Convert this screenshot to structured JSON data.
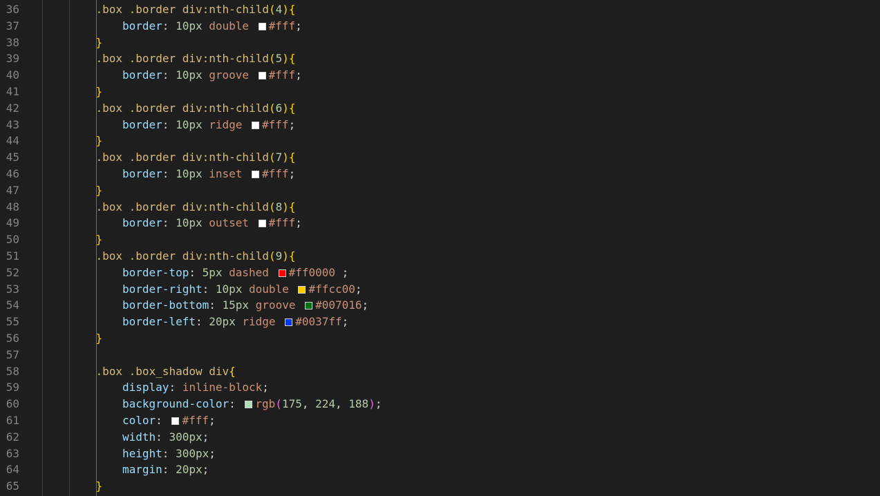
{
  "editor": {
    "language": "css",
    "line_count": 30,
    "lines": [
      {
        "num": "36",
        "indent": 1,
        "tokens": [
          {
            "t": ".box .border div:nth-child",
            "c": "sel"
          },
          {
            "t": "(",
            "c": "br"
          },
          {
            "t": "4",
            "c": "num"
          },
          {
            "t": ")",
            "c": "br"
          },
          {
            "t": "{",
            "c": "br"
          }
        ]
      },
      {
        "num": "37",
        "indent": 2,
        "tokens": [
          {
            "t": "border",
            "c": "prop"
          },
          {
            "t": ": ",
            "c": "punc"
          },
          {
            "t": "10px",
            "c": "num"
          },
          {
            "t": " double ",
            "c": "val"
          },
          {
            "swatch": "#ffffff",
            "name": "color-swatch"
          },
          {
            "t": "#fff",
            "c": "val"
          },
          {
            "t": ";",
            "c": "punc"
          }
        ]
      },
      {
        "num": "38",
        "indent": 1,
        "tokens": [
          {
            "t": "}",
            "c": "br"
          }
        ]
      },
      {
        "num": "39",
        "indent": 1,
        "tokens": [
          {
            "t": ".box .border div:nth-child",
            "c": "sel"
          },
          {
            "t": "(",
            "c": "br"
          },
          {
            "t": "5",
            "c": "num"
          },
          {
            "t": ")",
            "c": "br"
          },
          {
            "t": "{",
            "c": "br"
          }
        ]
      },
      {
        "num": "40",
        "indent": 2,
        "tokens": [
          {
            "t": "border",
            "c": "prop"
          },
          {
            "t": ": ",
            "c": "punc"
          },
          {
            "t": "10px",
            "c": "num"
          },
          {
            "t": " groove ",
            "c": "val"
          },
          {
            "swatch": "#ffffff",
            "name": "color-swatch"
          },
          {
            "t": "#fff",
            "c": "val"
          },
          {
            "t": ";",
            "c": "punc"
          }
        ]
      },
      {
        "num": "41",
        "indent": 1,
        "tokens": [
          {
            "t": "}",
            "c": "br"
          }
        ]
      },
      {
        "num": "42",
        "indent": 1,
        "tokens": [
          {
            "t": ".box .border div:nth-child",
            "c": "sel"
          },
          {
            "t": "(",
            "c": "br"
          },
          {
            "t": "6",
            "c": "num"
          },
          {
            "t": ")",
            "c": "br"
          },
          {
            "t": "{",
            "c": "br"
          }
        ]
      },
      {
        "num": "43",
        "indent": 2,
        "tokens": [
          {
            "t": "border",
            "c": "prop"
          },
          {
            "t": ": ",
            "c": "punc"
          },
          {
            "t": "10px",
            "c": "num"
          },
          {
            "t": " ridge ",
            "c": "val"
          },
          {
            "swatch": "#ffffff",
            "name": "color-swatch"
          },
          {
            "t": "#fff",
            "c": "val"
          },
          {
            "t": ";",
            "c": "punc"
          }
        ]
      },
      {
        "num": "44",
        "indent": 1,
        "tokens": [
          {
            "t": "}",
            "c": "br"
          }
        ]
      },
      {
        "num": "45",
        "indent": 1,
        "tokens": [
          {
            "t": ".box .border div:nth-child",
            "c": "sel"
          },
          {
            "t": "(",
            "c": "br"
          },
          {
            "t": "7",
            "c": "num"
          },
          {
            "t": ")",
            "c": "br"
          },
          {
            "t": "{",
            "c": "br"
          }
        ]
      },
      {
        "num": "46",
        "indent": 2,
        "tokens": [
          {
            "t": "border",
            "c": "prop"
          },
          {
            "t": ": ",
            "c": "punc"
          },
          {
            "t": "10px",
            "c": "num"
          },
          {
            "t": " inset ",
            "c": "val"
          },
          {
            "swatch": "#ffffff",
            "name": "color-swatch"
          },
          {
            "t": "#fff",
            "c": "val"
          },
          {
            "t": ";",
            "c": "punc"
          }
        ]
      },
      {
        "num": "47",
        "indent": 1,
        "tokens": [
          {
            "t": "}",
            "c": "br"
          }
        ]
      },
      {
        "num": "48",
        "indent": 1,
        "tokens": [
          {
            "t": ".box .border div:nth-child",
            "c": "sel"
          },
          {
            "t": "(",
            "c": "br"
          },
          {
            "t": "8",
            "c": "num"
          },
          {
            "t": ")",
            "c": "br"
          },
          {
            "t": "{",
            "c": "br"
          }
        ]
      },
      {
        "num": "49",
        "indent": 2,
        "tokens": [
          {
            "t": "border",
            "c": "prop"
          },
          {
            "t": ": ",
            "c": "punc"
          },
          {
            "t": "10px",
            "c": "num"
          },
          {
            "t": " outset ",
            "c": "val"
          },
          {
            "swatch": "#ffffff",
            "name": "color-swatch"
          },
          {
            "t": "#fff",
            "c": "val"
          },
          {
            "t": ";",
            "c": "punc"
          }
        ]
      },
      {
        "num": "50",
        "indent": 1,
        "tokens": [
          {
            "t": "}",
            "c": "br"
          }
        ]
      },
      {
        "num": "51",
        "indent": 1,
        "tokens": [
          {
            "t": ".box .border div:nth-child",
            "c": "sel"
          },
          {
            "t": "(",
            "c": "br"
          },
          {
            "t": "9",
            "c": "num"
          },
          {
            "t": ")",
            "c": "br"
          },
          {
            "t": "{",
            "c": "br"
          }
        ]
      },
      {
        "num": "52",
        "indent": 2,
        "tokens": [
          {
            "t": "border-top",
            "c": "prop"
          },
          {
            "t": ": ",
            "c": "punc"
          },
          {
            "t": "5px",
            "c": "num"
          },
          {
            "t": " dashed ",
            "c": "val"
          },
          {
            "swatch": "#ff0000",
            "name": "color-swatch"
          },
          {
            "t": "#ff0000",
            "c": "val"
          },
          {
            "t": " ;",
            "c": "punc"
          }
        ]
      },
      {
        "num": "53",
        "indent": 2,
        "tokens": [
          {
            "t": "border-right",
            "c": "prop"
          },
          {
            "t": ": ",
            "c": "punc"
          },
          {
            "t": "10px",
            "c": "num"
          },
          {
            "t": " double ",
            "c": "val"
          },
          {
            "swatch": "#ffcc00",
            "name": "color-swatch"
          },
          {
            "t": "#ffcc00",
            "c": "val"
          },
          {
            "t": ";",
            "c": "punc"
          }
        ]
      },
      {
        "num": "54",
        "indent": 2,
        "tokens": [
          {
            "t": "border-bottom",
            "c": "prop"
          },
          {
            "t": ": ",
            "c": "punc"
          },
          {
            "t": "15px",
            "c": "num"
          },
          {
            "t": " groove ",
            "c": "val"
          },
          {
            "swatch": "#007016",
            "name": "color-swatch"
          },
          {
            "t": "#007016",
            "c": "val"
          },
          {
            "t": ";",
            "c": "punc"
          }
        ]
      },
      {
        "num": "55",
        "indent": 2,
        "tokens": [
          {
            "t": "border-left",
            "c": "prop"
          },
          {
            "t": ": ",
            "c": "punc"
          },
          {
            "t": "20px",
            "c": "num"
          },
          {
            "t": " ridge ",
            "c": "val"
          },
          {
            "swatch": "#0037ff",
            "name": "color-swatch"
          },
          {
            "t": "#0037ff",
            "c": "val"
          },
          {
            "t": ";",
            "c": "punc"
          }
        ]
      },
      {
        "num": "56",
        "indent": 1,
        "tokens": [
          {
            "t": "}",
            "c": "br"
          }
        ]
      },
      {
        "num": "57",
        "indent": 0,
        "tokens": []
      },
      {
        "num": "58",
        "indent": 1,
        "tokens": [
          {
            "t": ".box .box_shadow div",
            "c": "sel"
          },
          {
            "t": "{",
            "c": "br"
          }
        ]
      },
      {
        "num": "59",
        "indent": 2,
        "tokens": [
          {
            "t": "display",
            "c": "prop"
          },
          {
            "t": ": ",
            "c": "punc"
          },
          {
            "t": "inline-block",
            "c": "val"
          },
          {
            "t": ";",
            "c": "punc"
          }
        ]
      },
      {
        "num": "60",
        "indent": 2,
        "tokens": [
          {
            "t": "background-color",
            "c": "prop"
          },
          {
            "t": ": ",
            "c": "punc"
          },
          {
            "swatch": "#afe0bc",
            "name": "color-swatch"
          },
          {
            "t": "rgb",
            "c": "val"
          },
          {
            "t": "(",
            "c": "br2"
          },
          {
            "t": "175",
            "c": "num"
          },
          {
            "t": ", ",
            "c": "punc"
          },
          {
            "t": "224",
            "c": "num"
          },
          {
            "t": ", ",
            "c": "punc"
          },
          {
            "t": "188",
            "c": "num"
          },
          {
            "t": ")",
            "c": "br2"
          },
          {
            "t": ";",
            "c": "punc"
          }
        ]
      },
      {
        "num": "61",
        "indent": 2,
        "tokens": [
          {
            "t": "color",
            "c": "prop"
          },
          {
            "t": ": ",
            "c": "punc"
          },
          {
            "swatch": "#ffffff",
            "name": "color-swatch"
          },
          {
            "t": "#fff",
            "c": "val"
          },
          {
            "t": ";",
            "c": "punc"
          }
        ]
      },
      {
        "num": "62",
        "indent": 2,
        "tokens": [
          {
            "t": "width",
            "c": "prop"
          },
          {
            "t": ": ",
            "c": "punc"
          },
          {
            "t": "300px",
            "c": "num"
          },
          {
            "t": ";",
            "c": "punc"
          }
        ]
      },
      {
        "num": "63",
        "indent": 2,
        "tokens": [
          {
            "t": "height",
            "c": "prop"
          },
          {
            "t": ": ",
            "c": "punc"
          },
          {
            "t": "300px",
            "c": "num"
          },
          {
            "t": ";",
            "c": "punc"
          }
        ]
      },
      {
        "num": "64",
        "indent": 2,
        "tokens": [
          {
            "t": "margin",
            "c": "prop"
          },
          {
            "t": ": ",
            "c": "punc"
          },
          {
            "t": "20px",
            "c": "num"
          },
          {
            "t": ";",
            "c": "punc"
          }
        ]
      },
      {
        "num": "65",
        "indent": 1,
        "tokens": [
          {
            "t": "}",
            "c": "br"
          }
        ]
      }
    ]
  },
  "theme": {
    "background": "#1e1e1e",
    "line_number": "#858585",
    "selector": "#d7ba7d",
    "bracket": "#ffd700",
    "bracket_nested": "#da70d6",
    "property": "#9cdcfe",
    "number": "#b5cea8",
    "value": "#ce9178",
    "punctuation": "#d4d4d4"
  }
}
